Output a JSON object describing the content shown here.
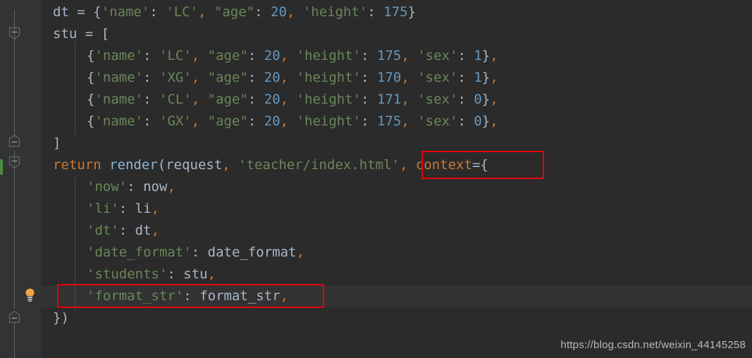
{
  "editor": {
    "theme": "darcula",
    "background": "#2b2b2b",
    "gutter_background": "#313335",
    "current_line_background": "#323232",
    "accent_annotation_color": "#e8000d",
    "change_marker_color": "#4a8c3f",
    "lines": [
      {
        "index": 0,
        "indent": 1,
        "text": "dt = {'name': 'LC', \"age\": 20, 'height': 175}"
      },
      {
        "index": 1,
        "indent": 1,
        "text": "stu = ["
      },
      {
        "index": 2,
        "indent": 2,
        "text": "{'name': 'LC', \"age\": 20, 'height': 175, 'sex': 1},"
      },
      {
        "index": 3,
        "indent": 2,
        "text": "{'name': 'XG', \"age\": 20, 'height': 170, 'sex': 1},"
      },
      {
        "index": 4,
        "indent": 2,
        "text": "{'name': 'CL', \"age\": 20, 'height': 171, 'sex': 0},"
      },
      {
        "index": 5,
        "indent": 2,
        "text": "{'name': 'GX', \"age\": 20, 'height': 175, 'sex': 0},"
      },
      {
        "index": 6,
        "indent": 1,
        "text": "]"
      },
      {
        "index": 7,
        "indent": 1,
        "text": "return render(request, 'teacher/index.html', context={"
      },
      {
        "index": 8,
        "indent": 2,
        "text": "'now': now,"
      },
      {
        "index": 9,
        "indent": 2,
        "text": "'li': li,"
      },
      {
        "index": 10,
        "indent": 2,
        "text": "'dt': dt,"
      },
      {
        "index": 11,
        "indent": 2,
        "text": "'date_format': date_format,"
      },
      {
        "index": 12,
        "indent": 2,
        "text": "'students': stu,"
      },
      {
        "index": 13,
        "indent": 2,
        "text": "'format_str': format_str,"
      },
      {
        "index": 14,
        "indent": 1,
        "text": "})"
      }
    ]
  },
  "gutter": {
    "fold_markers": [
      {
        "name": "fold-collapse-stu-list",
        "type": "fold-start",
        "line": 1
      },
      {
        "name": "fold-expand-list-end",
        "type": "fold-end",
        "line": 6
      },
      {
        "name": "fold-collapse-return-block",
        "type": "fold-start",
        "line": 7
      },
      {
        "name": "fold-expand-dict-end",
        "type": "fold-end",
        "line": 14
      }
    ],
    "intention_bulb": {
      "name": "intention-bulb-icon",
      "line": 13,
      "color": "#f2a641"
    },
    "change_marker": {
      "line": 7,
      "color": "#4a8c3f"
    }
  },
  "annotations": [
    {
      "name": "highlight-box-context-kwarg",
      "label": "context={"
    },
    {
      "name": "highlight-box-format-str-entry",
      "label": "'format_str': format_str,"
    }
  ],
  "watermark": {
    "text": "https://blog.csdn.net/weixin_44145258"
  }
}
